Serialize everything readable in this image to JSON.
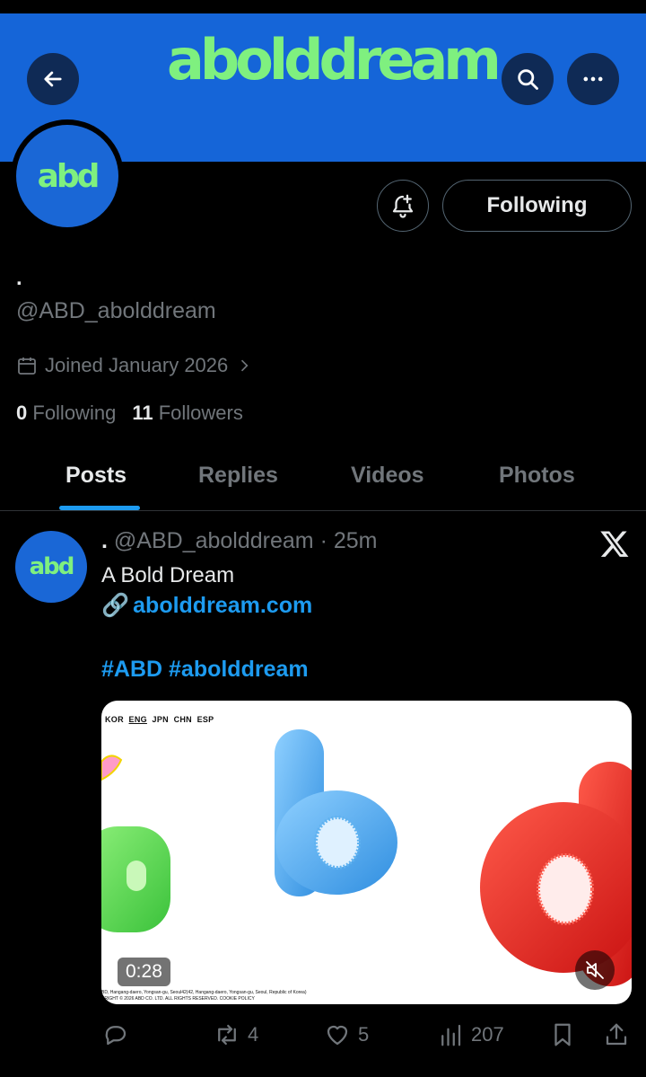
{
  "header": {
    "banner_logo_text": "abolddream",
    "back_icon": "arrow-left-icon",
    "search_icon": "search-icon",
    "more_icon": "more-icon"
  },
  "profile": {
    "avatar_text": "abd",
    "display_name": ".",
    "handle": "@ABD_abolddream",
    "joined": "Joined January 2026",
    "following_count": "0",
    "following_label": "Following",
    "followers_count": "11",
    "followers_label": "Followers",
    "follow_button_label": "Following",
    "notify_icon": "bell-plus-icon"
  },
  "tabs": [
    {
      "label": "Posts",
      "active": true
    },
    {
      "label": "Replies",
      "active": false
    },
    {
      "label": "Videos",
      "active": false
    },
    {
      "label": "Photos",
      "active": false
    }
  ],
  "post": {
    "avatar_text": "abd",
    "display_name": ".",
    "handle": "@ABD_abolddream",
    "time": "· 25m",
    "text": "A Bold Dream",
    "link_emoji": "🔗",
    "link": "abolddream.com",
    "hashtags": "#ABD #abolddream",
    "media": {
      "langs": [
        "KOR",
        "ENG",
        "JPN",
        "CHN",
        "ESP"
      ],
      "footer_line1": "BD, Hangang-daero, Yongsan-gu, Seoul42(42, Hangang-daero, Yongsan-gu, Seoul, Republic of Korea)",
      "footer_line2": "YRIGHT © 2026 ABD CO. LTD. ALL RIGHTS RESERVED. COOKIE POLICY",
      "letters": [
        "a",
        "b",
        "d"
      ],
      "duration": "0:28"
    },
    "actions": {
      "replies": "",
      "reposts": "4",
      "likes": "5",
      "views": "207"
    }
  },
  "colors": {
    "banner": "#1565d8",
    "logo_green": "#7ff07f",
    "link_blue": "#1d9bf0",
    "muted": "#71767b"
  }
}
